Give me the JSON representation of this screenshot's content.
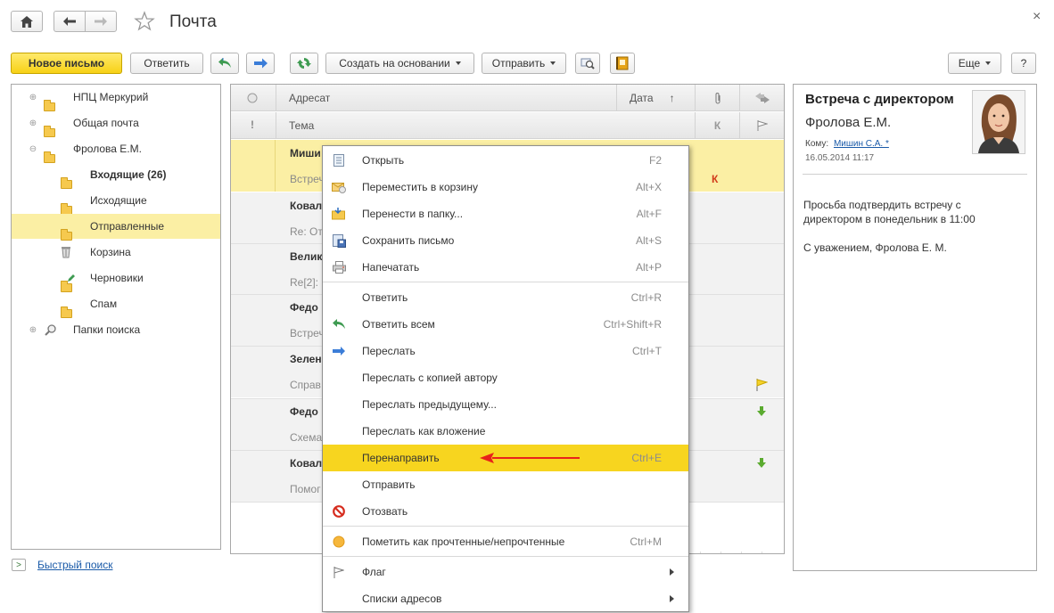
{
  "header": {
    "title": "Почта",
    "close": "×"
  },
  "toolbar": {
    "new_letter": "Новое письмо",
    "reply": "Ответить",
    "create_based": "Создать на основании",
    "send": "Отправить",
    "more": "Еще",
    "help": "?"
  },
  "tree": {
    "items": [
      {
        "label": "НПЦ Меркурий",
        "expander": "⊕"
      },
      {
        "label": "Общая почта",
        "expander": "⊕"
      },
      {
        "label": "Фролова Е.М.",
        "expander": "⊖"
      },
      {
        "label": "Входящие (26)"
      },
      {
        "label": "Исходящие"
      },
      {
        "label": "Отправленные"
      },
      {
        "label": "Корзина"
      },
      {
        "label": "Черновики"
      },
      {
        "label": "Спам"
      },
      {
        "label": "Папки поиска",
        "expander": "⊕"
      }
    ]
  },
  "quick_search": {
    "label": "Быстрый поиск",
    "icon": ">"
  },
  "list": {
    "col_addressee": "Адресат",
    "col_date": "Дата",
    "sort_arrow": "↑",
    "col_subject": "Тема",
    "importance": "!",
    "k_header": "К",
    "rows": [
      {
        "text": "Миши",
        "kind": "bold"
      },
      {
        "text": "Встреч",
        "kind": "light",
        "k": "К"
      },
      {
        "text": "Ковал",
        "kind": "bold"
      },
      {
        "text": "Re: От",
        "kind": "light"
      },
      {
        "text": "Велик",
        "kind": "bold"
      },
      {
        "text": "Re[2]:",
        "kind": "light"
      },
      {
        "text": "Федо",
        "kind": "bold"
      },
      {
        "text": "Встреч",
        "kind": "light"
      },
      {
        "text": "Зелен",
        "kind": "bold"
      },
      {
        "text": "Справ",
        "kind": "light"
      },
      {
        "text": "Федо",
        "kind": "bold"
      },
      {
        "text": "Схема",
        "kind": "light"
      },
      {
        "text": "Ковал",
        "kind": "bold"
      },
      {
        "text": "Помог",
        "kind": "light"
      }
    ]
  },
  "context_menu": {
    "items": [
      {
        "label": "Открыть",
        "key": "F2",
        "icon": "open-icon"
      },
      {
        "label": "Переместить в корзину",
        "key": "Alt+X",
        "icon": "trash-move-icon"
      },
      {
        "label": "Перенести в папку...",
        "key": "Alt+F",
        "icon": "folder-move-icon"
      },
      {
        "label": "Сохранить письмо",
        "key": "Alt+S",
        "icon": "save-icon"
      },
      {
        "label": "Напечатать",
        "key": "Alt+P",
        "icon": "print-icon"
      },
      {
        "label": "Ответить",
        "key": "Ctrl+R",
        "icon": ""
      },
      {
        "label": "Ответить всем",
        "key": "Ctrl+Shift+R",
        "icon": "reply-all-icon"
      },
      {
        "label": "Переслать",
        "key": "Ctrl+T",
        "icon": "forward-icon"
      },
      {
        "label": "Переслать с копией автору",
        "key": "",
        "icon": ""
      },
      {
        "label": "Переслать предыдущему...",
        "key": "",
        "icon": ""
      },
      {
        "label": "Переслать как вложение",
        "key": "",
        "icon": ""
      },
      {
        "label": "Перенаправить",
        "key": "Ctrl+E",
        "icon": ""
      },
      {
        "label": "Отправить",
        "key": "",
        "icon": ""
      },
      {
        "label": "Отозвать",
        "key": "",
        "icon": "recall-icon"
      },
      {
        "label": "Пометить как прочтенные/непрочтенные",
        "key": "Ctrl+M",
        "icon": "mark-read-icon"
      },
      {
        "label": "Флаг",
        "key": "",
        "icon": "flag-icon"
      },
      {
        "label": "Списки адресов",
        "key": "",
        "icon": ""
      }
    ]
  },
  "preview": {
    "subject": "Встреча с директором",
    "sender": "Фролова Е.М.",
    "to_label": "Кому:",
    "to_value": "Мишин С.А. *",
    "date": "16.05.2014 11:17",
    "body_line1": "Просьба подтвердить встречу с",
    "body_line2": "директором в понедельник в 11:00",
    "signature": "С уважением, Фролова Е. М."
  },
  "colors": {
    "accent_yellow": "#f7d51f",
    "selected_row": "#fbefa4",
    "arrow_red": "#e8221a",
    "link_blue": "#1a5aa8"
  }
}
